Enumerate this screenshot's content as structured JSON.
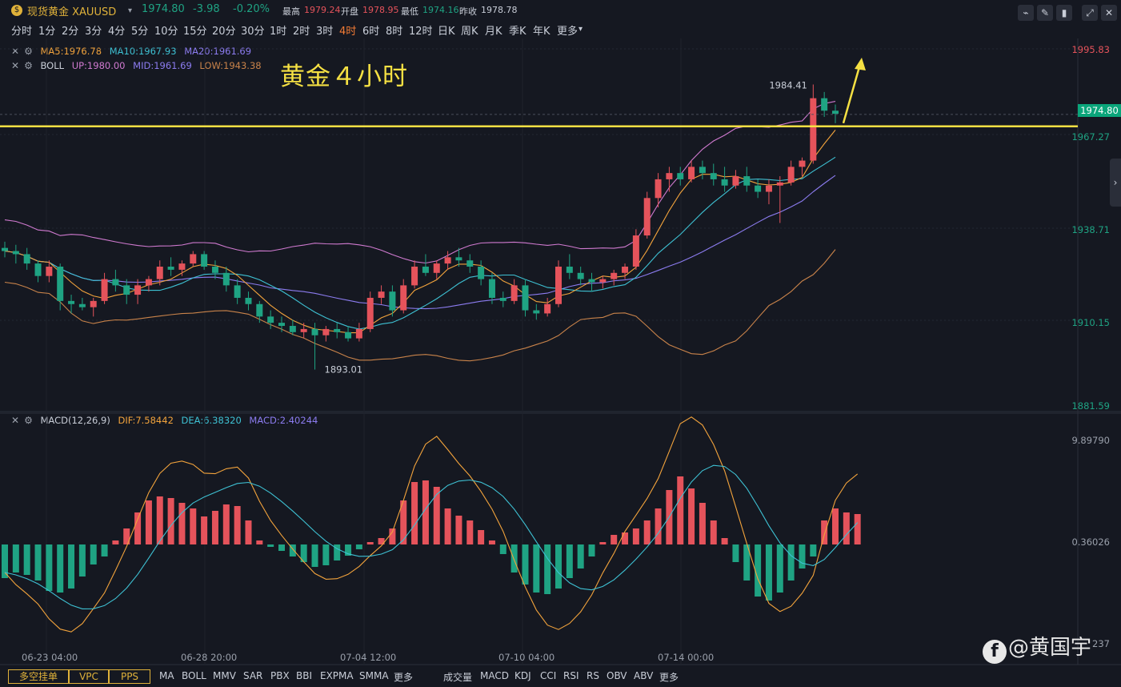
{
  "header": {
    "title": "现货黄金 XAUUSD",
    "last": "1974.80",
    "change": "-3.98",
    "change_pct": "-0.20%",
    "high_label": "最高",
    "high": "1979.24",
    "open_label": "开盘",
    "open": "1978.95",
    "low_label": "最低",
    "low": "1974.16",
    "prev_label": "昨收",
    "prev": "1978.78"
  },
  "timeframes": [
    "分时",
    "1分",
    "2分",
    "3分",
    "4分",
    "5分",
    "10分",
    "15分",
    "20分",
    "30分",
    "1时",
    "2时",
    "3时",
    "4时",
    "6时",
    "8时",
    "12时",
    "日K",
    "周K",
    "月K",
    "季K",
    "年K",
    "更多"
  ],
  "active_timeframe": "4时",
  "legend": {
    "ma": {
      "ma5": "MA5:1976.78",
      "ma10": "MA10:1967.93",
      "ma20": "MA20:1961.69"
    },
    "boll": {
      "name": "BOLL",
      "up": "UP:1980.00",
      "mid": "MID:1961.69",
      "low": "LOW:1943.38"
    },
    "macd": {
      "name": "MACD(12,26,9)",
      "dif": "DIF:7.58442",
      "dea": "DEA:6.38320",
      "macd": "MACD:2.40244"
    }
  },
  "annotation": "黄金４小时",
  "price_axis": [
    "1995.83",
    "1967.27",
    "1938.71",
    "1910.15",
    "1881.59"
  ],
  "current_price_tag": "1974.80",
  "macd_axis": [
    "9.89790",
    "0.36026"
  ],
  "macd_axis_cut": "237",
  "date_axis": [
    "06-23 04:00",
    "06-28 20:00",
    "07-04 12:00",
    "07-10 04:00",
    "07-14 00:00"
  ],
  "bottom_tabs": {
    "boxes": [
      "多空挂单",
      "VPC",
      "PPS"
    ],
    "indicators_main": [
      "MA",
      "BOLL",
      "MMV",
      "SAR",
      "PBX",
      "BBI",
      "EXPMA",
      "SMMA",
      "更多"
    ],
    "indicators_sub": [
      "成交量",
      "MACD",
      "KDJ",
      "CCI",
      "RSI",
      "RS",
      "OBV",
      "ABV",
      "更多"
    ]
  },
  "watermark": "@黄国宇",
  "colors": {
    "up": "#e5535b",
    "down": "#1fa383",
    "ma5": "#f2a33c",
    "ma10": "#3ec1d3",
    "ma20": "#8c7cf0",
    "boll_up": "#d07ad0",
    "boll_low": "#c9834a",
    "hline": "#f5e043"
  },
  "chart_data": {
    "type": "candlestick",
    "title": "",
    "price_range": [
      1881.59,
      1995.83
    ],
    "marked_high": "1984.41",
    "marked_low": "1893.01",
    "horizontal_line": 1971,
    "candles": [
      [
        1932,
        1934,
        1929,
        1931
      ],
      [
        1931,
        1933,
        1927,
        1930
      ],
      [
        1930,
        1932,
        1925,
        1927
      ],
      [
        1927,
        1928,
        1921,
        1923
      ],
      [
        1923,
        1928,
        1921,
        1926
      ],
      [
        1926,
        1927,
        1912,
        1915
      ],
      [
        1915,
        1917,
        1911,
        1914
      ],
      [
        1914,
        1916,
        1912,
        1913
      ],
      [
        1913,
        1916,
        1910,
        1915
      ],
      [
        1915,
        1924,
        1914,
        1922
      ],
      [
        1922,
        1925,
        1918,
        1920
      ],
      [
        1920,
        1922,
        1914,
        1917
      ],
      [
        1917,
        1922,
        1914,
        1920
      ],
      [
        1920,
        1923,
        1918,
        1922
      ],
      [
        1922,
        1928,
        1920,
        1926
      ],
      [
        1926,
        1929,
        1923,
        1925
      ],
      [
        1925,
        1928,
        1923,
        1927
      ],
      [
        1927,
        1931,
        1926,
        1930
      ],
      [
        1930,
        1931,
        1925,
        1926
      ],
      [
        1926,
        1928,
        1922,
        1924
      ],
      [
        1924,
        1926,
        1918,
        1920
      ],
      [
        1920,
        1922,
        1914,
        1916
      ],
      [
        1916,
        1918,
        1912,
        1914
      ],
      [
        1914,
        1915,
        1908,
        1910
      ],
      [
        1910,
        1912,
        1906,
        1908
      ],
      [
        1908,
        1910,
        1905,
        1907
      ],
      [
        1907,
        1909,
        1904,
        1905
      ],
      [
        1905,
        1908,
        1903,
        1906
      ],
      [
        1906,
        1908,
        1893,
        1904
      ],
      [
        1904,
        1907,
        1902,
        1906
      ],
      [
        1906,
        1908,
        1903,
        1905
      ],
      [
        1905,
        1907,
        1902,
        1903
      ],
      [
        1903,
        1908,
        1902,
        1906
      ],
      [
        1906,
        1918,
        1905,
        1916
      ],
      [
        1916,
        1920,
        1914,
        1918
      ],
      [
        1918,
        1920,
        1910,
        1912
      ],
      [
        1912,
        1922,
        1911,
        1920
      ],
      [
        1920,
        1928,
        1919,
        1926
      ],
      [
        1926,
        1930,
        1923,
        1924
      ],
      [
        1924,
        1928,
        1922,
        1927
      ],
      [
        1927,
        1931,
        1925,
        1929
      ],
      [
        1929,
        1932,
        1926,
        1928
      ],
      [
        1928,
        1930,
        1924,
        1926
      ],
      [
        1926,
        1928,
        1920,
        1922
      ],
      [
        1922,
        1924,
        1914,
        1916
      ],
      [
        1916,
        1918,
        1913,
        1915
      ],
      [
        1915,
        1922,
        1914,
        1920
      ],
      [
        1920,
        1922,
        1910,
        1912
      ],
      [
        1912,
        1914,
        1909,
        1911
      ],
      [
        1911,
        1916,
        1910,
        1914
      ],
      [
        1914,
        1928,
        1913,
        1926
      ],
      [
        1926,
        1930,
        1922,
        1924
      ],
      [
        1924,
        1926,
        1920,
        1922
      ],
      [
        1922,
        1924,
        1918,
        1921
      ],
      [
        1921,
        1923,
        1919,
        1922
      ],
      [
        1922,
        1925,
        1920,
        1924
      ],
      [
        1924,
        1927,
        1922,
        1926
      ],
      [
        1926,
        1938,
        1925,
        1936
      ],
      [
        1936,
        1950,
        1935,
        1948
      ],
      [
        1948,
        1956,
        1945,
        1954
      ],
      [
        1954,
        1958,
        1950,
        1956
      ],
      [
        1956,
        1958,
        1952,
        1954
      ],
      [
        1954,
        1960,
        1953,
        1958
      ],
      [
        1958,
        1960,
        1954,
        1956
      ],
      [
        1956,
        1959,
        1952,
        1954
      ],
      [
        1954,
        1958,
        1950,
        1952
      ],
      [
        1952,
        1957,
        1951,
        1955
      ],
      [
        1955,
        1958,
        1950,
        1952
      ],
      [
        1952,
        1954,
        1948,
        1950
      ],
      [
        1950,
        1954,
        1946,
        1952
      ],
      [
        1952,
        1955,
        1940,
        1953
      ],
      [
        1953,
        1960,
        1952,
        1958
      ],
      [
        1958,
        1961,
        1955,
        1960
      ],
      [
        1960,
        1984.41,
        1959,
        1980
      ],
      [
        1980,
        1982,
        1974,
        1976
      ],
      [
        1976,
        1978,
        1972,
        1975
      ]
    ],
    "macd_hist": [
      -4.2,
      -3.5,
      -3.8,
      -4.5,
      -5.8,
      -6.0,
      -5.5,
      -4.0,
      -2.5,
      -1.5,
      0.5,
      2.0,
      4.0,
      5.5,
      6.0,
      5.8,
      5.2,
      4.5,
      3.5,
      4.2,
      5.0,
      4.8,
      3.0,
      0.5,
      -0.3,
      -0.8,
      -1.5,
      -2.2,
      -2.8,
      -2.6,
      -2.0,
      -1.4,
      -0.6,
      0.3,
      0.8,
      2.0,
      5.5,
      7.8,
      8.0,
      7.2,
      4.5,
      3.6,
      3.0,
      1.8,
      0.5,
      -1.2,
      -3.5,
      -5.0,
      -6.0,
      -6.2,
      -5.5,
      -4.2,
      -3.0,
      -1.5,
      0.3,
      1.2,
      1.5,
      2.0,
      3.0,
      4.5,
      6.8,
      8.5,
      7.0,
      5.2,
      3.0,
      0.8,
      -2.2,
      -4.5,
      -6.5,
      -7.0,
      -6.0,
      -4.5,
      -3.0,
      -1.5,
      3.0,
      4.5,
      4.0,
      3.8
    ]
  }
}
